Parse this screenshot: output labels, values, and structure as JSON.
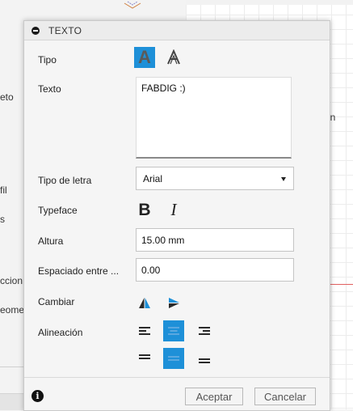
{
  "background": {
    "left_fragments": [
      "eto",
      "fil",
      "s",
      "ccion",
      "eomet"
    ],
    "right_fragments": [
      "ón"
    ]
  },
  "dialog": {
    "title": "TEXTO",
    "tipo_label": "Tipo",
    "texto_label": "Texto",
    "texto_value": "FABDIG :)",
    "font_label": "Tipo de letra",
    "font_value": "Arial",
    "typeface_label": "Typeface",
    "bold_glyph": "B",
    "italic_glyph": "I",
    "altura_label": "Altura",
    "altura_value": "15.00 mm",
    "espaciado_label": "Espaciado entre ...",
    "espaciado_value": "0.00",
    "cambiar_label": "Cambiar",
    "alineacion_label": "Alineación",
    "accept_label": "Aceptar",
    "cancel_label": "Cancelar",
    "accent_color": "#1e90d8"
  }
}
